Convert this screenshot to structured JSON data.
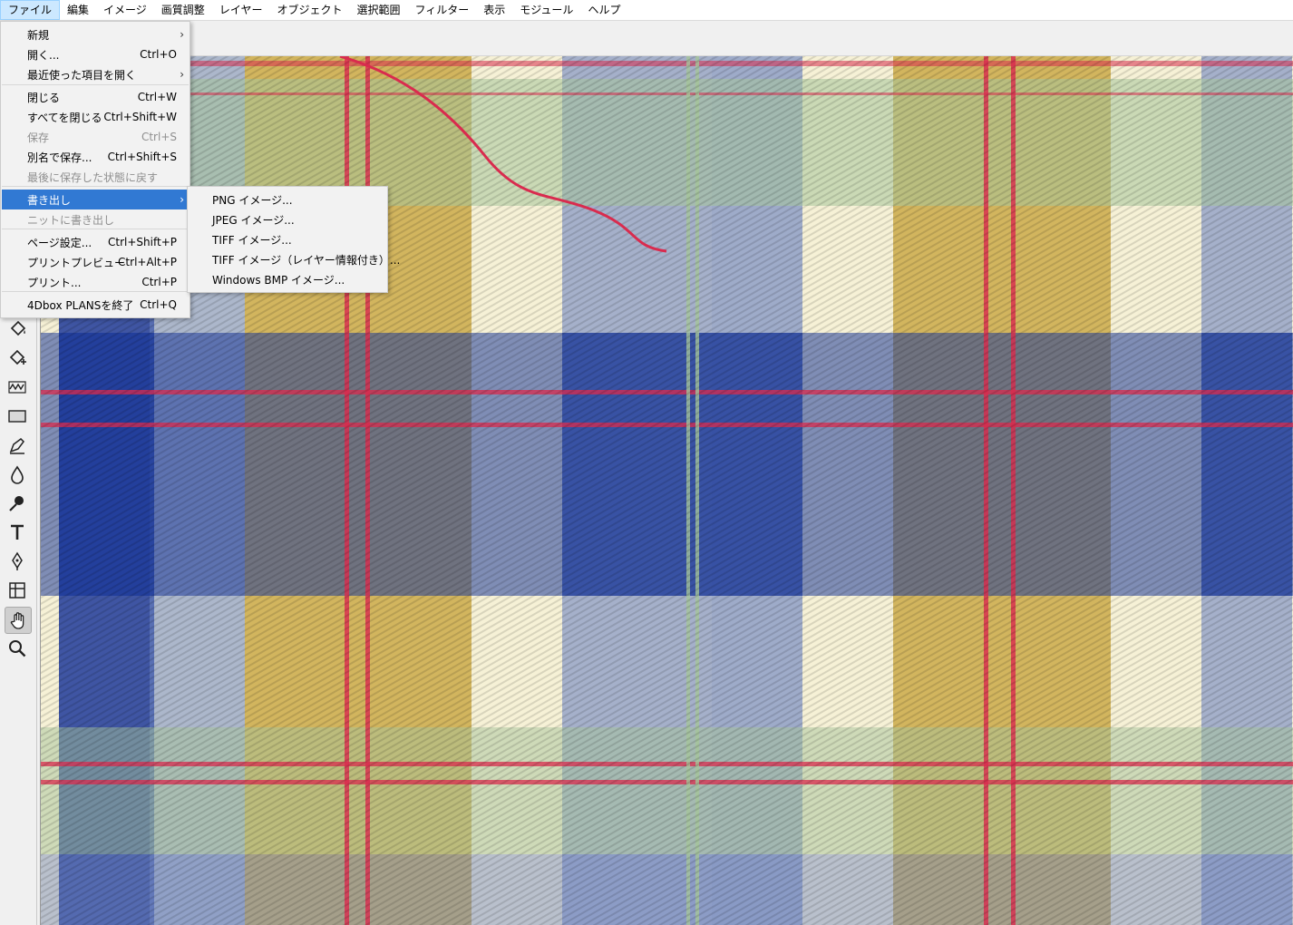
{
  "menubar": {
    "items": [
      "ファイル",
      "編集",
      "イメージ",
      "画質調整",
      "レイヤー",
      "オブジェクト",
      "選択範囲",
      "フィルター",
      "表示",
      "モジュール",
      "ヘルプ"
    ],
    "active_index": 0
  },
  "file_menu": {
    "items": [
      {
        "label": "新規",
        "shortcut": "",
        "submenu": true,
        "disabled": false
      },
      {
        "label": "開く...",
        "shortcut": "Ctrl+O",
        "submenu": false,
        "disabled": false
      },
      {
        "label": "最近使った項目を開く",
        "shortcut": "",
        "submenu": true,
        "disabled": false
      },
      {
        "label": "閉じる",
        "shortcut": "Ctrl+W",
        "submenu": false,
        "disabled": false
      },
      {
        "label": "すべてを閉じる",
        "shortcut": "Ctrl+Shift+W",
        "submenu": false,
        "disabled": false
      },
      {
        "label": "保存",
        "shortcut": "Ctrl+S",
        "submenu": false,
        "disabled": true
      },
      {
        "label": "別名で保存...",
        "shortcut": "Ctrl+Shift+S",
        "submenu": false,
        "disabled": false
      },
      {
        "label": "最後に保存した状態に戻す",
        "shortcut": "",
        "submenu": false,
        "disabled": true
      },
      {
        "label": "書き出し",
        "shortcut": "",
        "submenu": true,
        "disabled": false,
        "highlighted": true
      },
      {
        "label": "ニットに書き出し",
        "shortcut": "",
        "submenu": false,
        "disabled": true
      },
      {
        "label": "ページ設定...",
        "shortcut": "Ctrl+Shift+P",
        "submenu": false,
        "disabled": false
      },
      {
        "label": "プリントプレビュー",
        "shortcut": "Ctrl+Alt+P",
        "submenu": false,
        "disabled": false
      },
      {
        "label": "プリント...",
        "shortcut": "Ctrl+P",
        "submenu": false,
        "disabled": false
      },
      {
        "label": "4Dbox PLANSを終了",
        "shortcut": "Ctrl+Q",
        "submenu": false,
        "disabled": false
      }
    ]
  },
  "export_menu": {
    "items": [
      "PNG イメージ...",
      "JPEG イメージ...",
      "TIFF イメージ...",
      "TIFF イメージ（レイヤー情報付き）...",
      "Windows BMP イメージ..."
    ]
  },
  "tools": [
    {
      "name": "paint-bucket-icon",
      "selected": false
    },
    {
      "name": "paint-bucket-plus-icon",
      "selected": false
    },
    {
      "name": "wave-line-icon",
      "selected": false
    },
    {
      "name": "rectangle-icon",
      "selected": false
    },
    {
      "name": "pen-tool-icon",
      "selected": false
    },
    {
      "name": "drop-icon",
      "selected": false
    },
    {
      "name": "eyedropper-icon",
      "selected": false
    },
    {
      "name": "text-icon",
      "selected": false
    },
    {
      "name": "fountain-pen-icon",
      "selected": false
    },
    {
      "name": "grid-icon",
      "selected": false
    },
    {
      "name": "hand-icon",
      "selected": true
    },
    {
      "name": "zoom-icon",
      "selected": false
    }
  ],
  "colors": {
    "menu_highlight": "#3179d3",
    "plaid_cream": "#f6f1d6",
    "plaid_blue": "#1e3a9a",
    "plaid_light_blue": "#6f86c2",
    "plaid_green": "#a5c49a",
    "plaid_yellow": "#c9a640",
    "plaid_red": "#d92b4e"
  }
}
